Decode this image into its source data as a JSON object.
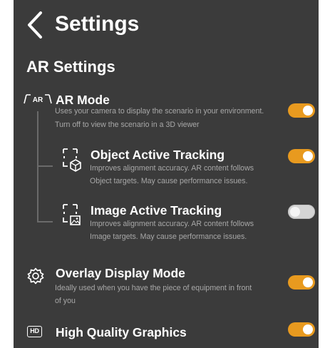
{
  "header": {
    "title": "Settings"
  },
  "section": {
    "title": "AR Settings"
  },
  "settings": {
    "ar_mode": {
      "icon_text": "AR",
      "label": "AR Mode",
      "desc_line1": "Uses your camera to display the scenario in your environment.",
      "desc_line2": "Turn off to view the scenario in a 3D viewer",
      "enabled": true
    },
    "object_tracking": {
      "label": "Object Active Tracking",
      "desc_line1": "Improves alignment accuracy. AR content follows",
      "desc_line2": "Object targets. May cause performance issues.",
      "enabled": true
    },
    "image_tracking": {
      "label": "Image Active Tracking",
      "desc_line1": "Improves alignment accuracy. AR content follows",
      "desc_line2": "Image targets. May cause performance issues.",
      "enabled": false
    },
    "overlay_display": {
      "label": "Overlay Display Mode",
      "desc_line1": "Ideally used when you have the piece of equipment in front",
      "desc_line2": "of you",
      "enabled": true
    },
    "high_quality": {
      "icon_text": "HD",
      "label": "High Quality Graphics",
      "enabled": true
    }
  },
  "colors": {
    "background": "#3b3b3b",
    "accent": "#e89a1f",
    "toggle_off": "#d4d4d4",
    "text_primary": "#ffffff",
    "text_secondary": "#a8a8a8"
  }
}
